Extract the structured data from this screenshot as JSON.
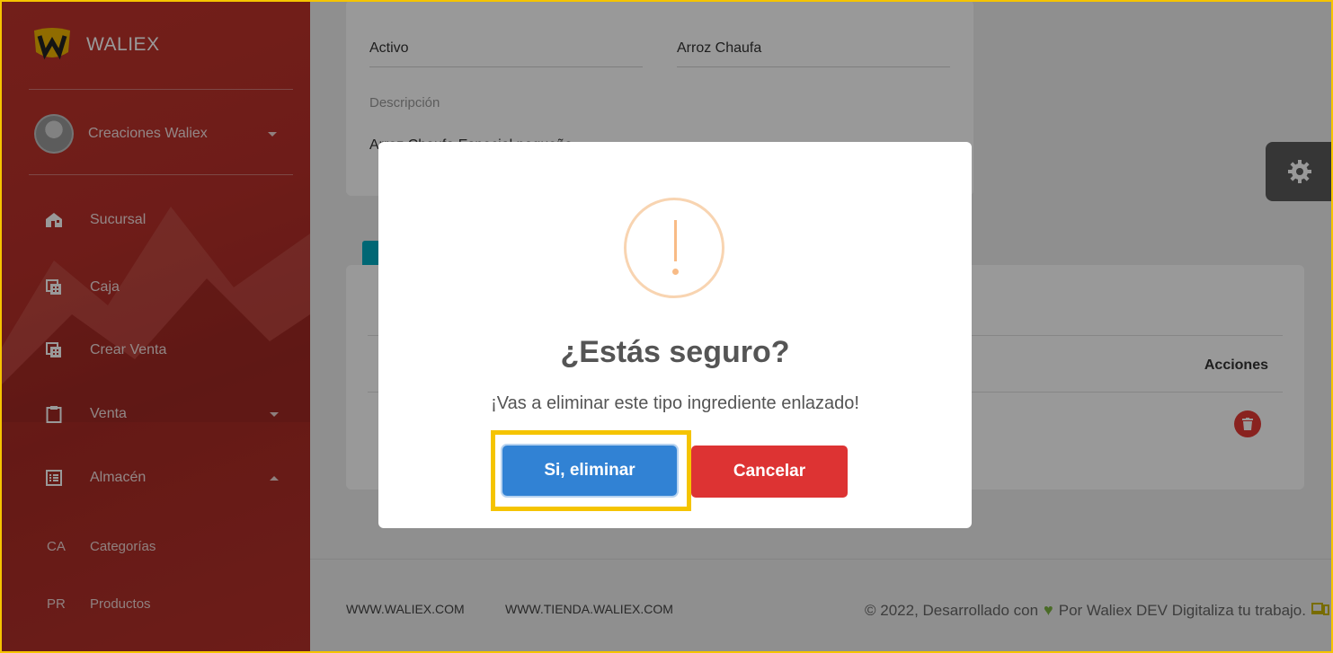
{
  "sidebar": {
    "brand": "WALIEX",
    "user": "Creaciones Waliex",
    "items": [
      {
        "label": "Sucursal",
        "icon": "home-icon"
      },
      {
        "label": "Caja",
        "icon": "cash-register-icon"
      },
      {
        "label": "Crear Venta",
        "icon": "cash-register-icon"
      },
      {
        "label": "Venta",
        "icon": "clipboard-icon"
      },
      {
        "label": "Almacén",
        "icon": "list-icon"
      }
    ],
    "subitems": [
      {
        "abbr": "CA",
        "label": "Categorías"
      },
      {
        "abbr": "PR",
        "label": "Productos"
      }
    ]
  },
  "form": {
    "estado_value": "Activo",
    "categoria_value": "Arroz Chaufa",
    "descripcion_label": "Descripción",
    "descripcion_value": "Arroz Chaufa Especial pequeño"
  },
  "table": {
    "actions_header": "Acciones"
  },
  "footer": {
    "link1": "WWW.WALIEX.COM",
    "link2": "WWW.TIENDA.WALIEX.COM",
    "copy_prefix": "© 2022, Desarrollado con",
    "copy_suffix": "Por Waliex DEV Digitaliza tu trabajo."
  },
  "modal": {
    "title": "¿Estás seguro?",
    "text": "¡Vas a eliminar este tipo ingrediente enlazado!",
    "confirm_label": "Si, eliminar",
    "cancel_label": "Cancelar"
  },
  "colors": {
    "sidebar": "#b8302a",
    "confirm": "#3182d4",
    "cancel": "#dd3333",
    "warning": "#f8bb86",
    "highlight": "#f5c400"
  }
}
